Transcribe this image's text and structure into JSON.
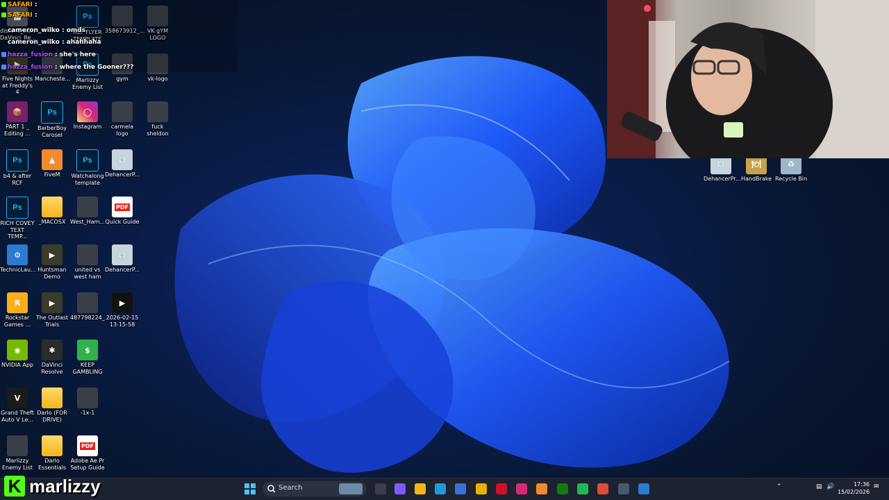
{
  "chat": [
    {
      "user": "SAFARI",
      "text": "",
      "user_color": "#ffb000"
    },
    {
      "user": "SAFARI",
      "text": "",
      "user_color": "#ffb000"
    },
    {
      "user": "cameron_wilko",
      "text": "omds",
      "user_color": "#ffffff"
    },
    {
      "user": "cameron_wilko",
      "text": "ahahhaha",
      "user_color": "#ffffff"
    },
    {
      "user": "hazza_fusion",
      "text": "she's here",
      "user_color": "#b04cff"
    },
    {
      "user": "hazza_fusion",
      "text": "where the Gooner???",
      "user_color": "#b04cff"
    }
  ],
  "desktop_icons": [
    {
      "label": "discord_ba... DaVinci_Re...",
      "icon": "file-icon"
    },
    {
      "label": "RCF FLYER TEMPLATE",
      "icon": "photoshop-icon"
    },
    {
      "label": "358673912_...",
      "icon": "image-icon"
    },
    {
      "label": "VK gYM LOGO",
      "icon": "image-icon"
    },
    {
      "label": "Five Nights at Freddy's 4",
      "icon": "game-icon"
    },
    {
      "label": "Mancheste...",
      "icon": "image-icon"
    },
    {
      "label": "Marlizzy Enemy List",
      "icon": "photoshop-icon"
    },
    {
      "label": "gym",
      "icon": "image-icon"
    },
    {
      "label": "vk-logo",
      "icon": "image-icon"
    },
    {
      "label": "PART 1 _ Editing ...",
      "icon": "winrar-icon"
    },
    {
      "label": "BarberBoy Carosel",
      "icon": "photoshop-icon"
    },
    {
      "label": "Instagram",
      "icon": "instagram-icon"
    },
    {
      "label": "carmela logo",
      "icon": "image-icon"
    },
    {
      "label": "fuck sheldon",
      "icon": "image-icon"
    },
    {
      "label": "b4 & after RCF",
      "icon": "photoshop-icon"
    },
    {
      "label": "FiveM",
      "icon": "fivem-icon"
    },
    {
      "label": "Watchalong template",
      "icon": "photoshop-icon"
    },
    {
      "label": "DehancerP...",
      "icon": "installer-icon"
    },
    {
      "label": "RICH COVEY TEXT TEMP...",
      "icon": "photoshop-icon"
    },
    {
      "label": "_MACOSX",
      "icon": "folder-icon"
    },
    {
      "label": "West_Ham...",
      "icon": "image-icon"
    },
    {
      "label": "Quick Guide",
      "icon": "pdf-icon"
    },
    {
      "label": "TechnicLau...",
      "icon": "technic-icon"
    },
    {
      "label": "Huntsman Demo",
      "icon": "game-icon"
    },
    {
      "label": "united vs west ham",
      "icon": "image-icon"
    },
    {
      "label": "DehancerP...",
      "icon": "installer-icon"
    },
    {
      "label": "Rockstar Games ...",
      "icon": "rockstar-icon"
    },
    {
      "label": "The Outlast Trials",
      "icon": "game-icon"
    },
    {
      "label": "487798224_...",
      "icon": "image-icon"
    },
    {
      "label": "2026-02-15 13-15-58",
      "icon": "video-icon"
    },
    {
      "label": "NVIDIA App",
      "icon": "nvidia-icon"
    },
    {
      "label": "DaVinci Resolve",
      "icon": "davinci-icon"
    },
    {
      "label": "KEEP GAMBLING",
      "icon": "dollar-icon"
    },
    {
      "label": "Grand Theft Auto V Le...",
      "icon": "gta-icon"
    },
    {
      "label": "Darlo (FOR DRIVE)",
      "icon": "folder-icon"
    },
    {
      "label": "-1x-1",
      "icon": "image-icon"
    },
    {
      "label": "Marlizzy Enemy List",
      "icon": "image-icon"
    },
    {
      "label": "Darlo Essentials",
      "icon": "folder-icon"
    },
    {
      "label": "Adobe Ae Pr Setup Guide",
      "icon": "pdf-icon"
    },
    {
      "label": "DehancerPr...",
      "icon": "installer-icon"
    },
    {
      "label": "HandBrake",
      "icon": "handbrake-icon"
    },
    {
      "label": "Recycle Bin",
      "icon": "recycle-bin-icon"
    }
  ],
  "overlay": {
    "logo_letter": "K",
    "name": "marlizzy"
  },
  "taskbar": {
    "search_placeholder": "Search",
    "time": "17:36",
    "date": "15/02/2026"
  },
  "colors": {
    "accent": "#1f5bff",
    "taskbar": "#1c2230"
  }
}
